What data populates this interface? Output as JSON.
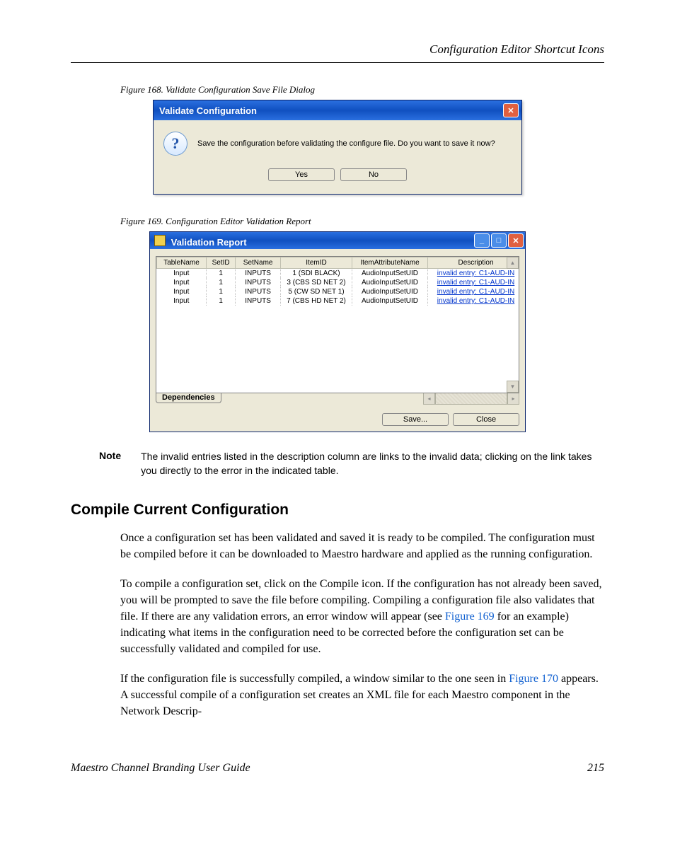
{
  "header": {
    "right": "Configuration Editor Shortcut Icons"
  },
  "fig168": {
    "caption": "Figure 168.  Validate Configuration Save File Dialog"
  },
  "dialog1": {
    "title": "Validate Configuration",
    "message": "Save the configuration before validating the configure file. Do you want to save it now?",
    "yes": "Yes",
    "no": "No"
  },
  "fig169": {
    "caption": "Figure 169.  Configuration Editor Validation Report"
  },
  "vreport": {
    "title": "Validation Report",
    "tab": "Dependencies",
    "save": "Save...",
    "close": "Close",
    "columns": {
      "table_name": "TableName",
      "set_id": "SetID",
      "set_name": "SetName",
      "item_id": "ItemID",
      "item_attr": "ItemAttributeName",
      "desc": "Description"
    },
    "rows": [
      {
        "table_name": "Input",
        "set_id": "1",
        "set_name": "INPUTS",
        "item_id": "1 (SDI BLACK)",
        "item_attr": "AudioInputSetUID",
        "desc": "invalid entry: C1-AUD-IN"
      },
      {
        "table_name": "Input",
        "set_id": "1",
        "set_name": "INPUTS",
        "item_id": "3 (CBS SD NET 2)",
        "item_attr": "AudioInputSetUID",
        "desc": "invalid entry: C1-AUD-IN"
      },
      {
        "table_name": "Input",
        "set_id": "1",
        "set_name": "INPUTS",
        "item_id": "5 (CW SD NET 1)",
        "item_attr": "AudioInputSetUID",
        "desc": "invalid entry: C1-AUD-IN"
      },
      {
        "table_name": "Input",
        "set_id": "1",
        "set_name": "INPUTS",
        "item_id": "7 (CBS HD NET 2)",
        "item_attr": "AudioInputSetUID",
        "desc": "invalid entry: C1-AUD-IN"
      }
    ]
  },
  "note": {
    "label": "Note",
    "text": "The invalid entries listed in the description column are links to the invalid data; clicking on the link takes you directly to the error in the indicated table."
  },
  "section": {
    "title": "Compile Current Configuration"
  },
  "para1": "Once a configuration set has been validated and saved it is ready to be compiled. The configuration must be compiled before it can be downloaded to Maestro hardware and applied as the running configuration.",
  "para2_a": "To compile a configuration set, click on the Compile icon. If the configuration has not already been saved, you will be prompted to save the file before compiling. Compiling a configuration file also validates that file. If there are any validation errors, an error window will appear (see ",
  "para2_link": "Figure 169",
  "para2_b": " for an example) indicating what items in the configuration need to be corrected before the configuration set can be successfully validated and compiled for use.",
  "para3_a": "If the configuration file is successfully compiled, a window similar to the one seen in ",
  "para3_link": "Figure 170",
  "para3_b": " appears. A successful compile of a configuration set creates an XML file for each Maestro component in the Network Descrip-",
  "footer": {
    "title": "Maestro Channel Branding User Guide",
    "page": "215"
  }
}
